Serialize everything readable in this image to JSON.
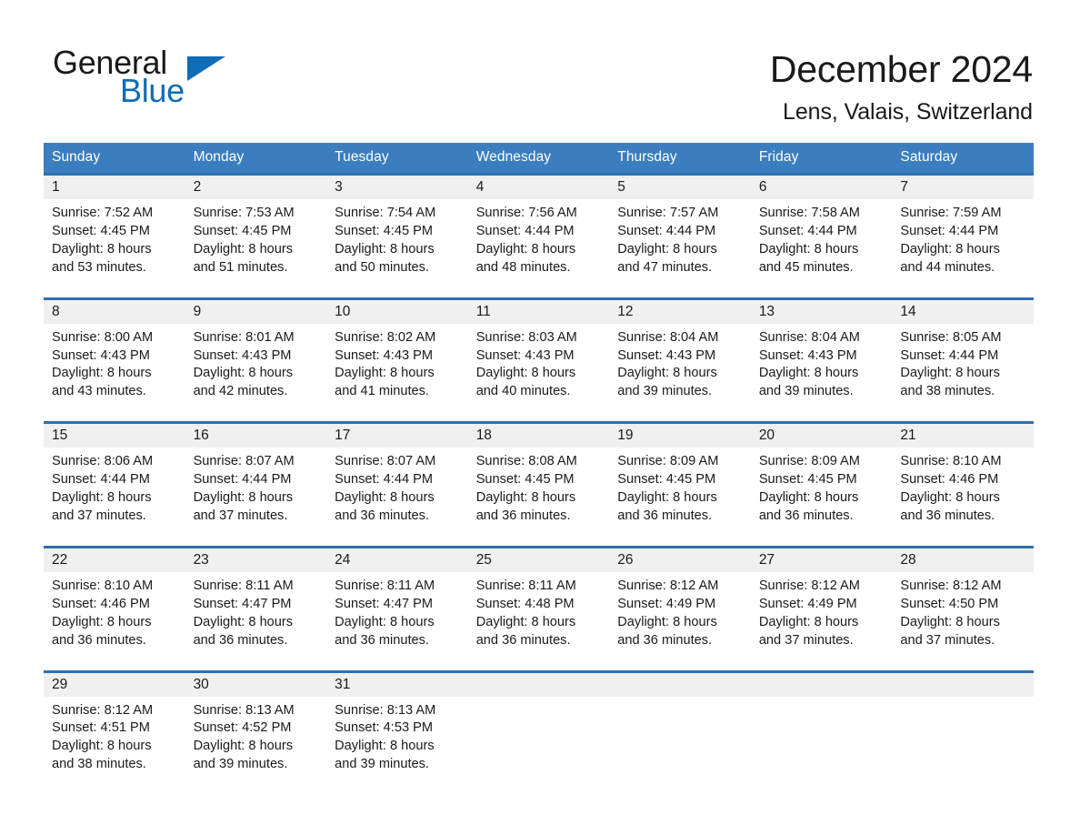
{
  "brand": {
    "name_part1": "General",
    "name_part2": "Blue",
    "triangle_color": "#0f6cb6"
  },
  "header": {
    "month_title": "December 2024",
    "location": "Lens, Valais, Switzerland"
  },
  "theme": {
    "header_blue": "#3a7ebf",
    "row_rule_blue": "#2f6fae",
    "daynum_band": "#f0f0f0",
    "text": "#1a1a1a"
  },
  "weekday_headers": [
    "Sunday",
    "Monday",
    "Tuesday",
    "Wednesday",
    "Thursday",
    "Friday",
    "Saturday"
  ],
  "weeks": [
    [
      {
        "day": "1",
        "sunrise": "Sunrise: 7:52 AM",
        "sunset": "Sunset: 4:45 PM",
        "daylight_line1": "Daylight: 8 hours",
        "daylight_line2": "and 53 minutes."
      },
      {
        "day": "2",
        "sunrise": "Sunrise: 7:53 AM",
        "sunset": "Sunset: 4:45 PM",
        "daylight_line1": "Daylight: 8 hours",
        "daylight_line2": "and 51 minutes."
      },
      {
        "day": "3",
        "sunrise": "Sunrise: 7:54 AM",
        "sunset": "Sunset: 4:45 PM",
        "daylight_line1": "Daylight: 8 hours",
        "daylight_line2": "and 50 minutes."
      },
      {
        "day": "4",
        "sunrise": "Sunrise: 7:56 AM",
        "sunset": "Sunset: 4:44 PM",
        "daylight_line1": "Daylight: 8 hours",
        "daylight_line2": "and 48 minutes."
      },
      {
        "day": "5",
        "sunrise": "Sunrise: 7:57 AM",
        "sunset": "Sunset: 4:44 PM",
        "daylight_line1": "Daylight: 8 hours",
        "daylight_line2": "and 47 minutes."
      },
      {
        "day": "6",
        "sunrise": "Sunrise: 7:58 AM",
        "sunset": "Sunset: 4:44 PM",
        "daylight_line1": "Daylight: 8 hours",
        "daylight_line2": "and 45 minutes."
      },
      {
        "day": "7",
        "sunrise": "Sunrise: 7:59 AM",
        "sunset": "Sunset: 4:44 PM",
        "daylight_line1": "Daylight: 8 hours",
        "daylight_line2": "and 44 minutes."
      }
    ],
    [
      {
        "day": "8",
        "sunrise": "Sunrise: 8:00 AM",
        "sunset": "Sunset: 4:43 PM",
        "daylight_line1": "Daylight: 8 hours",
        "daylight_line2": "and 43 minutes."
      },
      {
        "day": "9",
        "sunrise": "Sunrise: 8:01 AM",
        "sunset": "Sunset: 4:43 PM",
        "daylight_line1": "Daylight: 8 hours",
        "daylight_line2": "and 42 minutes."
      },
      {
        "day": "10",
        "sunrise": "Sunrise: 8:02 AM",
        "sunset": "Sunset: 4:43 PM",
        "daylight_line1": "Daylight: 8 hours",
        "daylight_line2": "and 41 minutes."
      },
      {
        "day": "11",
        "sunrise": "Sunrise: 8:03 AM",
        "sunset": "Sunset: 4:43 PM",
        "daylight_line1": "Daylight: 8 hours",
        "daylight_line2": "and 40 minutes."
      },
      {
        "day": "12",
        "sunrise": "Sunrise: 8:04 AM",
        "sunset": "Sunset: 4:43 PM",
        "daylight_line1": "Daylight: 8 hours",
        "daylight_line2": "and 39 minutes."
      },
      {
        "day": "13",
        "sunrise": "Sunrise: 8:04 AM",
        "sunset": "Sunset: 4:43 PM",
        "daylight_line1": "Daylight: 8 hours",
        "daylight_line2": "and 39 minutes."
      },
      {
        "day": "14",
        "sunrise": "Sunrise: 8:05 AM",
        "sunset": "Sunset: 4:44 PM",
        "daylight_line1": "Daylight: 8 hours",
        "daylight_line2": "and 38 minutes."
      }
    ],
    [
      {
        "day": "15",
        "sunrise": "Sunrise: 8:06 AM",
        "sunset": "Sunset: 4:44 PM",
        "daylight_line1": "Daylight: 8 hours",
        "daylight_line2": "and 37 minutes."
      },
      {
        "day": "16",
        "sunrise": "Sunrise: 8:07 AM",
        "sunset": "Sunset: 4:44 PM",
        "daylight_line1": "Daylight: 8 hours",
        "daylight_line2": "and 37 minutes."
      },
      {
        "day": "17",
        "sunrise": "Sunrise: 8:07 AM",
        "sunset": "Sunset: 4:44 PM",
        "daylight_line1": "Daylight: 8 hours",
        "daylight_line2": "and 36 minutes."
      },
      {
        "day": "18",
        "sunrise": "Sunrise: 8:08 AM",
        "sunset": "Sunset: 4:45 PM",
        "daylight_line1": "Daylight: 8 hours",
        "daylight_line2": "and 36 minutes."
      },
      {
        "day": "19",
        "sunrise": "Sunrise: 8:09 AM",
        "sunset": "Sunset: 4:45 PM",
        "daylight_line1": "Daylight: 8 hours",
        "daylight_line2": "and 36 minutes."
      },
      {
        "day": "20",
        "sunrise": "Sunrise: 8:09 AM",
        "sunset": "Sunset: 4:45 PM",
        "daylight_line1": "Daylight: 8 hours",
        "daylight_line2": "and 36 minutes."
      },
      {
        "day": "21",
        "sunrise": "Sunrise: 8:10 AM",
        "sunset": "Sunset: 4:46 PM",
        "daylight_line1": "Daylight: 8 hours",
        "daylight_line2": "and 36 minutes."
      }
    ],
    [
      {
        "day": "22",
        "sunrise": "Sunrise: 8:10 AM",
        "sunset": "Sunset: 4:46 PM",
        "daylight_line1": "Daylight: 8 hours",
        "daylight_line2": "and 36 minutes."
      },
      {
        "day": "23",
        "sunrise": "Sunrise: 8:11 AM",
        "sunset": "Sunset: 4:47 PM",
        "daylight_line1": "Daylight: 8 hours",
        "daylight_line2": "and 36 minutes."
      },
      {
        "day": "24",
        "sunrise": "Sunrise: 8:11 AM",
        "sunset": "Sunset: 4:47 PM",
        "daylight_line1": "Daylight: 8 hours",
        "daylight_line2": "and 36 minutes."
      },
      {
        "day": "25",
        "sunrise": "Sunrise: 8:11 AM",
        "sunset": "Sunset: 4:48 PM",
        "daylight_line1": "Daylight: 8 hours",
        "daylight_line2": "and 36 minutes."
      },
      {
        "day": "26",
        "sunrise": "Sunrise: 8:12 AM",
        "sunset": "Sunset: 4:49 PM",
        "daylight_line1": "Daylight: 8 hours",
        "daylight_line2": "and 36 minutes."
      },
      {
        "day": "27",
        "sunrise": "Sunrise: 8:12 AM",
        "sunset": "Sunset: 4:49 PM",
        "daylight_line1": "Daylight: 8 hours",
        "daylight_line2": "and 37 minutes."
      },
      {
        "day": "28",
        "sunrise": "Sunrise: 8:12 AM",
        "sunset": "Sunset: 4:50 PM",
        "daylight_line1": "Daylight: 8 hours",
        "daylight_line2": "and 37 minutes."
      }
    ],
    [
      {
        "day": "29",
        "sunrise": "Sunrise: 8:12 AM",
        "sunset": "Sunset: 4:51 PM",
        "daylight_line1": "Daylight: 8 hours",
        "daylight_line2": "and 38 minutes."
      },
      {
        "day": "30",
        "sunrise": "Sunrise: 8:13 AM",
        "sunset": "Sunset: 4:52 PM",
        "daylight_line1": "Daylight: 8 hours",
        "daylight_line2": "and 39 minutes."
      },
      {
        "day": "31",
        "sunrise": "Sunrise: 8:13 AM",
        "sunset": "Sunset: 4:53 PM",
        "daylight_line1": "Daylight: 8 hours",
        "daylight_line2": "and 39 minutes."
      },
      {
        "day": "",
        "sunrise": "",
        "sunset": "",
        "daylight_line1": "",
        "daylight_line2": ""
      },
      {
        "day": "",
        "sunrise": "",
        "sunset": "",
        "daylight_line1": "",
        "daylight_line2": ""
      },
      {
        "day": "",
        "sunrise": "",
        "sunset": "",
        "daylight_line1": "",
        "daylight_line2": ""
      },
      {
        "day": "",
        "sunrise": "",
        "sunset": "",
        "daylight_line1": "",
        "daylight_line2": ""
      }
    ]
  ]
}
